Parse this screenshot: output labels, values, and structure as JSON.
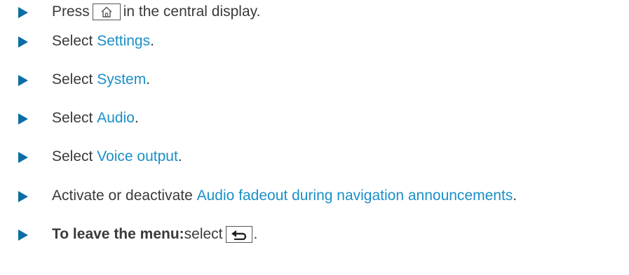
{
  "steps": [
    {
      "before": "Press ",
      "icon": "home-icon",
      "after": " in the central display."
    },
    {
      "before": "Select ",
      "link": "Settings",
      "after": "."
    },
    {
      "before": "Select ",
      "link": "System",
      "after": "."
    },
    {
      "before": "Select ",
      "link": "Audio",
      "after": "."
    },
    {
      "before": "Select ",
      "link": "Voice output",
      "after": "."
    },
    {
      "before": "Activate or deactivate ",
      "link": "Audio fadeout during navigation announcements",
      "after": "."
    },
    {
      "bold": "To leave the menu:",
      "before": " select ",
      "icon": "back-icon",
      "after": "."
    }
  ],
  "colors": {
    "bullet": "#0b6da6",
    "link": "#1a8fc6",
    "text": "#3a3a3a"
  }
}
